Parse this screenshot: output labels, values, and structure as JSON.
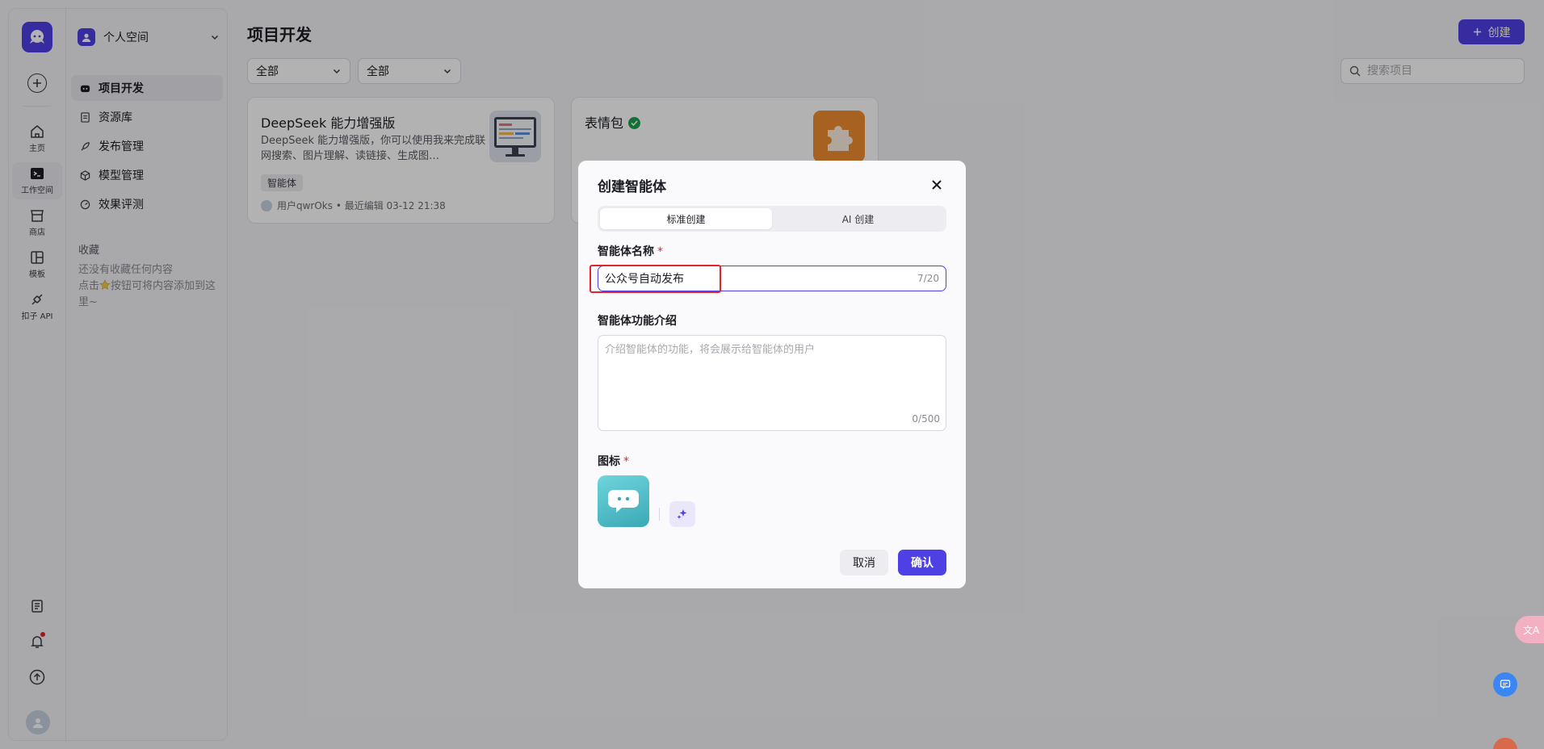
{
  "rail": {
    "items": [
      {
        "label": "主页"
      },
      {
        "label": "工作空间"
      },
      {
        "label": "商店"
      },
      {
        "label": "模板"
      },
      {
        "label": "扣子 API"
      }
    ]
  },
  "sidebar": {
    "space_name": "个人空间",
    "nav": [
      {
        "label": "项目开发"
      },
      {
        "label": "资源库"
      },
      {
        "label": "发布管理"
      },
      {
        "label": "模型管理"
      },
      {
        "label": "效果评测"
      }
    ],
    "favorites_title": "收藏",
    "favorites_empty_line1": "还没有收藏任何内容",
    "favorites_empty_line2_pre": "点击",
    "favorites_empty_line2_post": "按钮可将内容添加到这里~"
  },
  "main": {
    "title": "项目开发",
    "create_label": "创建",
    "filter1": "全部",
    "filter2": "全部",
    "search_placeholder": "搜索项目",
    "cards": [
      {
        "title": "DeepSeek 能力增强版",
        "desc": "DeepSeek 能力增强版，你可以使用我来完成联网搜索、图片理解、读链接、生成图…",
        "tag": "智能体",
        "meta": "用户qwrOks • 最近编辑 03-12 21:38"
      },
      {
        "title": "表情包"
      }
    ]
  },
  "modal": {
    "title": "创建智能体",
    "tabs": [
      {
        "label": "标准创建"
      },
      {
        "label": "AI 创建"
      }
    ],
    "name_label": "智能体名称",
    "name_value": "公众号自动发布",
    "name_counter": "7/20",
    "desc_label": "智能体功能介绍",
    "desc_placeholder": "介绍智能体的功能，将会展示给智能体的用户",
    "desc_counter": "0/500",
    "icon_label": "图标",
    "required_mark": "*",
    "cancel_label": "取消",
    "confirm_label": "确认"
  },
  "floating": {
    "translate_label": "文A"
  },
  "colors": {
    "accent": "#4e40e5",
    "highlight": "#e5232a"
  }
}
